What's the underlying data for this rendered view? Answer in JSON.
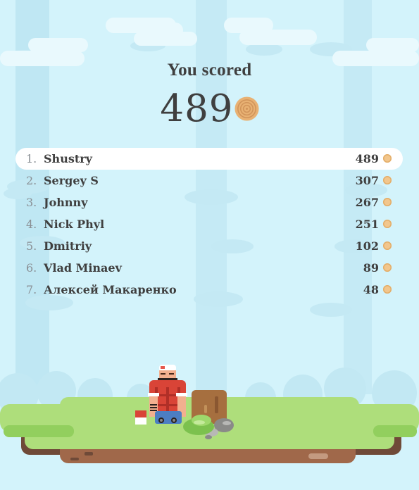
{
  "result": {
    "title": "You scored",
    "score": "489"
  },
  "leaderboard": [
    {
      "rank": "1.",
      "name": "Shustry",
      "score": "489",
      "highlight": true
    },
    {
      "rank": "2.",
      "name": "Sergey S",
      "score": "307",
      "highlight": false
    },
    {
      "rank": "3.",
      "name": "Johnny",
      "score": "267",
      "highlight": false
    },
    {
      "rank": "4.",
      "name": "Nick Phyl",
      "score": "251",
      "highlight": false
    },
    {
      "rank": "5.",
      "name": "Dmitriy",
      "score": "102",
      "highlight": false
    },
    {
      "rank": "6.",
      "name": "Vlad Minaev",
      "score": "89",
      "highlight": false
    },
    {
      "rank": "7.",
      "name": "Алексей Макаренко",
      "score": "48",
      "highlight": false
    }
  ],
  "icons": {
    "score_coin": "wood-ring-coin-icon",
    "row_coin": "coin-icon"
  },
  "colors": {
    "sky": "#d3f3fb",
    "grass": "#aede7b",
    "dirt": "#a0684a",
    "coin": "#f2c68c",
    "text": "#3f3f3f"
  }
}
